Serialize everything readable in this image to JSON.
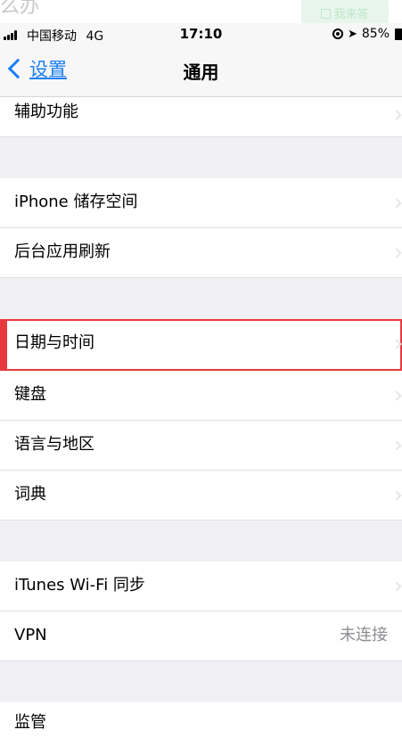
{
  "overlay": {
    "question_text": "么办",
    "answer_button": "我来答"
  },
  "status_bar": {
    "carrier": "中国移动",
    "network": "4G",
    "time": "17:10",
    "battery": "85%"
  },
  "nav": {
    "back_label": "设置",
    "title": "通用"
  },
  "rows": {
    "accessibility": "辅助功能",
    "storage": "iPhone 储存空间",
    "background_refresh": "后台应用刷新",
    "date_time": "日期与时间",
    "keyboard": "键盘",
    "language_region": "语言与地区",
    "dictionary": "词典",
    "itunes_wifi_sync": "iTunes Wi-Fi 同步",
    "vpn": "VPN",
    "vpn_status": "未连接",
    "regulatory": "监管"
  },
  "colors": {
    "accent": "#1a7ff4",
    "highlight": "#e8393f",
    "background": "#efeff4"
  }
}
